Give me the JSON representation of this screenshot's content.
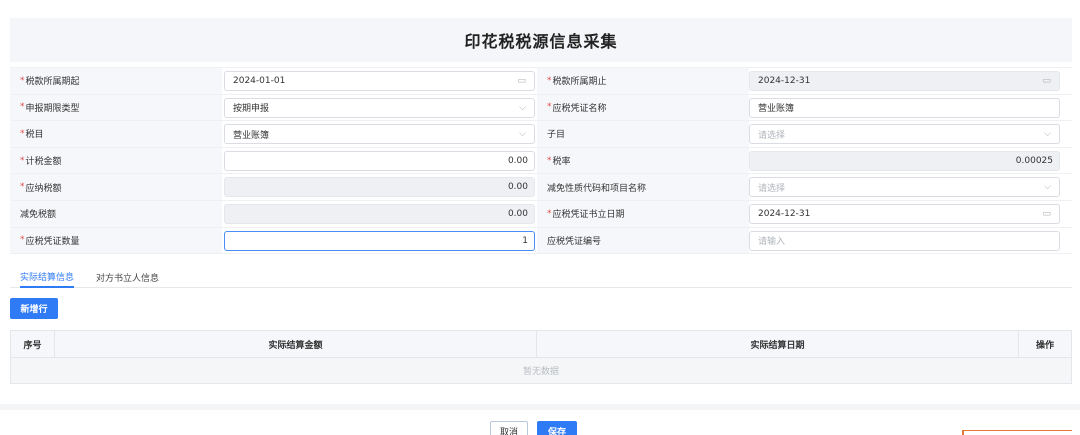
{
  "page": {
    "title": "印花税税源信息采集"
  },
  "form": {
    "rows": [
      {
        "left_label": "税款所属期起",
        "left_required": "*",
        "left_value": "2024-01-01",
        "left_icon": "calendar-icon",
        "right_label": "税款所属期止",
        "right_required": "*",
        "right_value": "2024-12-31",
        "right_icon": "calendar-icon"
      },
      {
        "left_label": "申报期限类型",
        "left_required": "*",
        "left_value": "按期申报",
        "left_icon": "chevron-down-icon",
        "right_label": "应税凭证名称",
        "right_required": "*",
        "right_value": "营业账簿"
      },
      {
        "left_label": "税目",
        "left_required": "*",
        "left_value": "营业账簿",
        "left_icon": "chevron-down-icon",
        "right_label": "子目",
        "right_placeholder": "请选择",
        "right_icon": "chevron-down-icon"
      },
      {
        "left_label": "计税金额",
        "left_required": "*",
        "left_value": "0.00",
        "right_label": "税率",
        "right_required": "*",
        "right_value": "0.00025"
      },
      {
        "left_label": "应纳税额",
        "left_required": "*",
        "left_value": "0.00",
        "right_label": "减免性质代码和项目名称",
        "right_placeholder": "请选择",
        "right_icon": "chevron-down-icon"
      },
      {
        "left_label": "减免税额",
        "left_value": "0.00",
        "right_label": "应税凭证书立日期",
        "right_required": "*",
        "right_value": "2024-12-31",
        "right_icon": "calendar-icon"
      },
      {
        "left_label": "应税凭证数量",
        "left_required": "*",
        "left_value": "1",
        "right_label": "应税凭证编号",
        "right_placeholder": "请输入"
      }
    ]
  },
  "tabs": [
    {
      "label": "实际结算信息",
      "active": true
    },
    {
      "label": "对方书立人信息",
      "active": false
    }
  ],
  "toolbar": {
    "add_label": "新增行"
  },
  "table": {
    "columns": [
      "序号",
      "实际结算金额",
      "实际结算日期",
      "操作"
    ],
    "empty_text": "暂无数据"
  },
  "footer": {
    "cancel_label": "取消",
    "save_label": "保存"
  },
  "colors": {
    "primary": "#2f7bf5",
    "required": "#e34d4d",
    "label_bg": "#f5f7fa",
    "disabled_bg": "#eef0f3"
  }
}
